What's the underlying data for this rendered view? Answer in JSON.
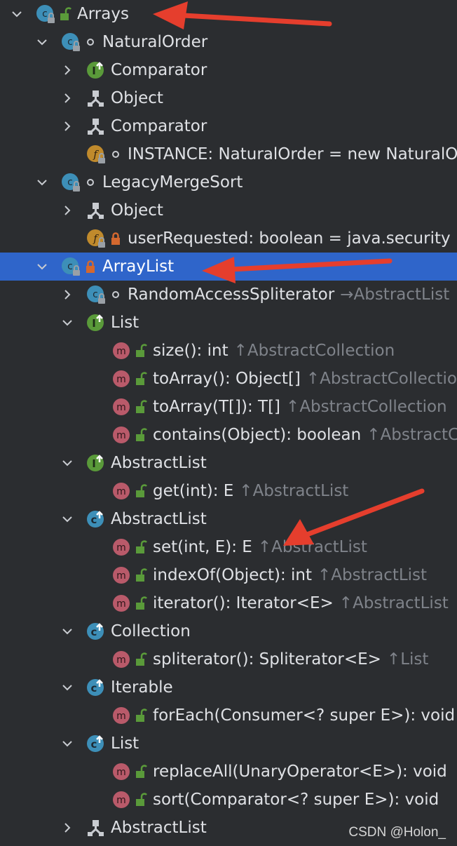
{
  "colors": {
    "background": "#2b2d30",
    "selection": "#2f65ca",
    "class_icon": "#3d8fb8",
    "interface_icon": "#5a9a3a",
    "method_icon": "#b95a6a",
    "field_icon": "#c08a2c",
    "lock_open": "#5a9a3a",
    "lock_private": "#d4682f",
    "inherited_text": "#7f838a",
    "annotation_arrow": "#e53e2d"
  },
  "rows": [
    {
      "indent": 0,
      "expander": "expanded",
      "icon": "class-icon",
      "vis": "public-lock-icon",
      "name": "Arrays"
    },
    {
      "indent": 1,
      "expander": "expanded",
      "icon": "class-icon",
      "vis": "package-dot-icon",
      "name": "NaturalOrder"
    },
    {
      "indent": 2,
      "expander": "collapsed",
      "icon": "interface-inherit-icon",
      "vis": "",
      "name": "Comparator"
    },
    {
      "indent": 2,
      "expander": "collapsed",
      "icon": "hierarchy-icon",
      "vis": "",
      "name": "Object"
    },
    {
      "indent": 2,
      "expander": "collapsed",
      "icon": "hierarchy-icon",
      "vis": "",
      "name": "Comparator"
    },
    {
      "indent": 2,
      "expander": "none",
      "icon": "field-icon",
      "vis": "package-dot-icon",
      "name": "INSTANCE: NaturalOrder = new NaturalOrder()"
    },
    {
      "indent": 1,
      "expander": "expanded",
      "icon": "class-icon",
      "vis": "package-dot-icon",
      "name": "LegacyMergeSort"
    },
    {
      "indent": 2,
      "expander": "collapsed",
      "icon": "hierarchy-icon",
      "vis": "",
      "name": "Object"
    },
    {
      "indent": 2,
      "expander": "none",
      "icon": "field-icon",
      "vis": "private-lock-icon",
      "name": "userRequested: boolean = java.security"
    },
    {
      "indent": 1,
      "expander": "expanded",
      "icon": "class-icon",
      "vis": "private-lock-icon",
      "name": "ArrayList",
      "selected": true
    },
    {
      "indent": 2,
      "expander": "collapsed",
      "icon": "class-icon",
      "vis": "package-dot-icon",
      "name": "RandomAccessSpliterator",
      "inherited": "→AbstractList"
    },
    {
      "indent": 2,
      "expander": "expanded",
      "icon": "interface-inherit-icon",
      "vis": "",
      "name": "List"
    },
    {
      "indent": 3,
      "expander": "none",
      "icon": "method-icon",
      "vis": "public-lock-icon",
      "name": "size(): int",
      "inherited": "↑AbstractCollection"
    },
    {
      "indent": 3,
      "expander": "none",
      "icon": "method-icon",
      "vis": "public-lock-icon",
      "name": "toArray(): Object[]",
      "inherited": "↑AbstractCollection"
    },
    {
      "indent": 3,
      "expander": "none",
      "icon": "method-icon",
      "vis": "public-lock-icon",
      "name": "toArray(T[]): T[]",
      "inherited": "↑AbstractCollection"
    },
    {
      "indent": 3,
      "expander": "none",
      "icon": "method-icon",
      "vis": "public-lock-icon",
      "name": "contains(Object): boolean",
      "inherited": "↑AbstractCollection"
    },
    {
      "indent": 2,
      "expander": "expanded",
      "icon": "interface-inherit-icon",
      "vis": "",
      "name": "AbstractList"
    },
    {
      "indent": 3,
      "expander": "none",
      "icon": "method-icon",
      "vis": "public-lock-icon",
      "name": "get(int): E",
      "inherited": "↑AbstractList"
    },
    {
      "indent": 2,
      "expander": "expanded",
      "icon": "class-inherit-icon",
      "vis": "",
      "name": "AbstractList"
    },
    {
      "indent": 3,
      "expander": "none",
      "icon": "method-icon",
      "vis": "public-lock-icon",
      "name": "set(int, E): E",
      "inherited": "↑AbstractList"
    },
    {
      "indent": 3,
      "expander": "none",
      "icon": "method-icon",
      "vis": "public-lock-icon",
      "name": "indexOf(Object): int",
      "inherited": "↑AbstractList"
    },
    {
      "indent": 3,
      "expander": "none",
      "icon": "method-icon",
      "vis": "public-lock-icon",
      "name": "iterator(): Iterator<E>",
      "inherited": "↑AbstractList"
    },
    {
      "indent": 2,
      "expander": "expanded",
      "icon": "class-inherit-icon",
      "vis": "",
      "name": "Collection"
    },
    {
      "indent": 3,
      "expander": "none",
      "icon": "method-icon",
      "vis": "public-lock-icon",
      "name": "spliterator(): Spliterator<E>",
      "inherited": "↑List"
    },
    {
      "indent": 2,
      "expander": "expanded",
      "icon": "class-inherit-icon",
      "vis": "",
      "name": "Iterable"
    },
    {
      "indent": 3,
      "expander": "none",
      "icon": "method-icon",
      "vis": "public-lock-icon",
      "name": "forEach(Consumer<? super E>): void"
    },
    {
      "indent": 2,
      "expander": "expanded",
      "icon": "class-inherit-icon",
      "vis": "",
      "name": "List"
    },
    {
      "indent": 3,
      "expander": "none",
      "icon": "method-icon",
      "vis": "public-lock-icon",
      "name": "replaceAll(UnaryOperator<E>): void"
    },
    {
      "indent": 3,
      "expander": "none",
      "icon": "method-icon",
      "vis": "public-lock-icon",
      "name": "sort(Comparator<? super E>): void"
    },
    {
      "indent": 2,
      "expander": "collapsed",
      "icon": "hierarchy-icon",
      "vis": "",
      "name": "AbstractList"
    }
  ],
  "watermark": "CSDN @Holon_"
}
